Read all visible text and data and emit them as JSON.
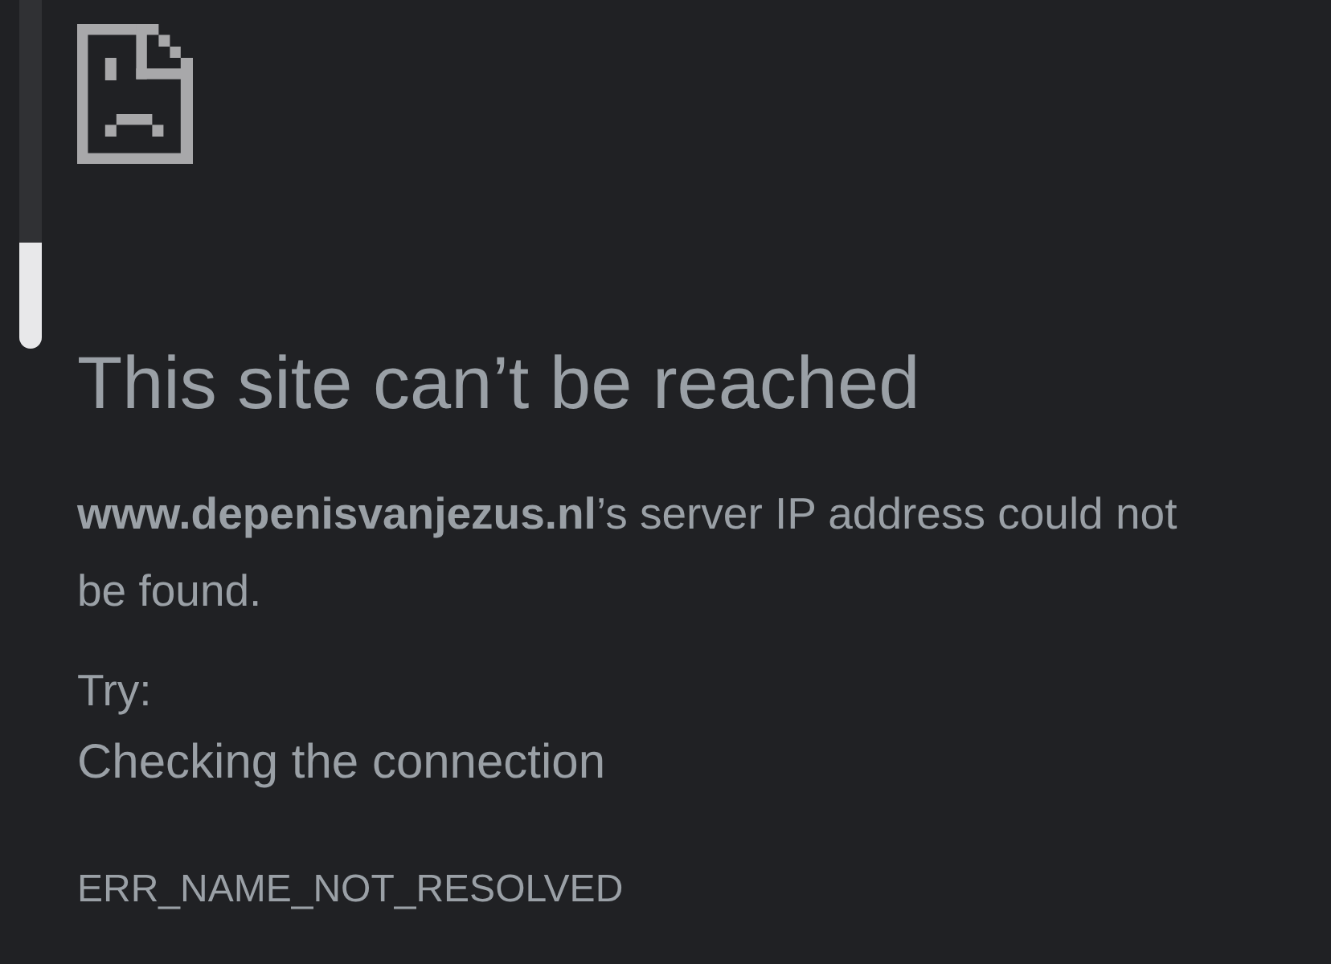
{
  "error_page": {
    "title": "This site can’t be reached",
    "message": "**www.depenisvanjezus.nl**’s server IP address could not be found.",
    "try_label": "Try:",
    "suggestions": [
      "Checking the connection"
    ],
    "error_code": "ERR_NAME_NOT_RESOLVED"
  }
}
